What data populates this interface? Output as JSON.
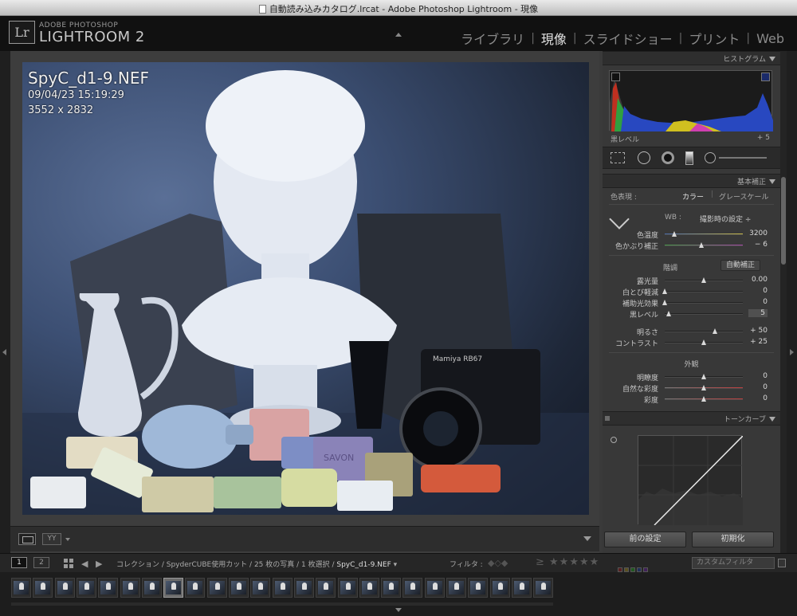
{
  "window": {
    "title": "自動読み込みカタログ.lrcat - Adobe Photoshop Lightroom - 現像"
  },
  "identity": {
    "small": "ADOBE PHOTOSHOP",
    "big": "LIGHTROOM 2",
    "badge": "Lr"
  },
  "modules": [
    "ライブラリ",
    "現像",
    "スライドショー",
    "プリント",
    "Web"
  ],
  "active_module": "現像",
  "photo": {
    "file_name": "SpyC_d1-9.NEF",
    "datetime": "09/04/23 15:19:29",
    "dimensions": "3552 x 2832"
  },
  "panels": {
    "histogram": {
      "header": "ヒストグラム",
      "footer_label": "黒レベル",
      "footer_value": "+ 5"
    },
    "basic": {
      "header": "基本補正",
      "color_mode_label": "色表現 :",
      "color_option": "カラー",
      "gray_option": "グレースケール",
      "wb_label": "WB :",
      "wb_value": "撮影時の設定 ÷",
      "tone_head": "階調",
      "auto_button": "自動補正",
      "presence_head": "外観",
      "sliders": [
        {
          "label": "色温度",
          "value": "3200",
          "pos": 0.12
        },
        {
          "label": "色かぶり補正",
          "value": "− 6",
          "pos": 0.47
        },
        {
          "label": "露光量",
          "value": "0.00",
          "pos": 0.5
        },
        {
          "label": "白とび軽減",
          "value": "0",
          "pos": 0.0
        },
        {
          "label": "補助光効果",
          "value": "0",
          "pos": 0.0
        },
        {
          "label": "黒レベル",
          "value": "5",
          "pos": 0.05
        },
        {
          "label": "明るさ",
          "value": "+ 50",
          "pos": 0.64
        },
        {
          "label": "コントラスト",
          "value": "+ 25",
          "pos": 0.5
        },
        {
          "label": "明瞭度",
          "value": "0",
          "pos": 0.5
        },
        {
          "label": "自然な彩度",
          "value": "0",
          "pos": 0.5
        },
        {
          "label": "彩度",
          "value": "0",
          "pos": 0.5
        }
      ]
    },
    "tone_curve": {
      "header": "トーンカーブ"
    },
    "buttons": {
      "previous": "前の設定",
      "reset": "初期化"
    }
  },
  "filmstrip": {
    "screen1": "1",
    "screen2": "2",
    "path_prefix": "コレクション / SpyderCUBE使用カット / 25 枚の写真 / 1 枚選択 /",
    "path_current": "SpyC_d1-9.NEF",
    "filter_label": "フィルタ :",
    "stars": "≥ ★★★★★",
    "filter_select": "カスタムフィルタ",
    "thumb_count": 25,
    "selected_index": 7
  },
  "colors": {
    "chrome": "#111111",
    "panel_bg": "#383838",
    "label_red": "#b04040",
    "label_yellow": "#b0a040",
    "label_green": "#40a040",
    "label_blue": "#4060b0",
    "label_purple": "#8040a0"
  }
}
